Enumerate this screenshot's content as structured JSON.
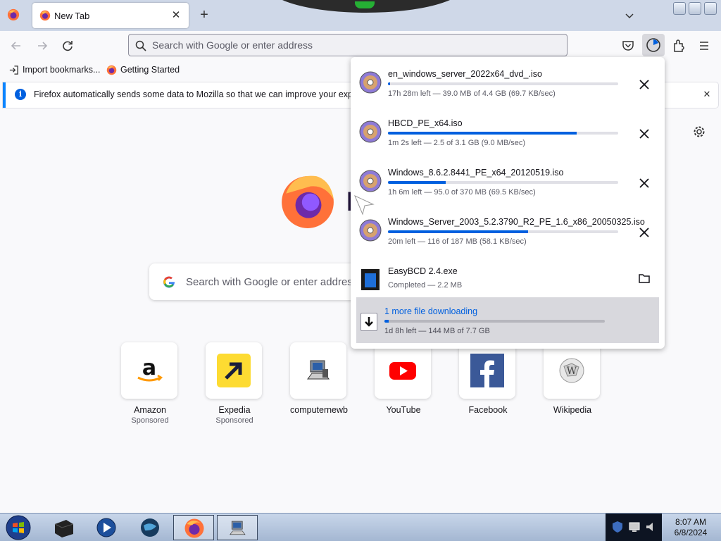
{
  "tabbar": {
    "tab_title": "New Tab",
    "new_tab_glyph": "+",
    "close_glyph": "✕"
  },
  "navbar": {
    "url_placeholder": "Search with Google or enter address"
  },
  "bookmarks": [
    {
      "label": "Import bookmarks...",
      "icon": "import-icon"
    },
    {
      "label": "Getting Started",
      "icon": "firefox-icon"
    }
  ],
  "notice": {
    "text": "Firefox automatically sends some data to Mozilla so that we can improve your experience."
  },
  "newtab": {
    "search_placeholder": "Search with Google or enter address",
    "tiles": [
      {
        "label": "Amazon",
        "sub": "Sponsored",
        "icon": "amazon-icon"
      },
      {
        "label": "Expedia",
        "sub": "Sponsored",
        "icon": "expedia-icon"
      },
      {
        "label": "computernewb",
        "sub": "",
        "icon": "computer-icon"
      },
      {
        "label": "YouTube",
        "sub": "",
        "icon": "youtube-icon"
      },
      {
        "label": "Facebook",
        "sub": "",
        "icon": "facebook-icon"
      },
      {
        "label": "Wikipedia",
        "sub": "",
        "icon": "wikipedia-icon"
      }
    ]
  },
  "downloads": {
    "items": [
      {
        "name": "en_windows_server_2022x64_dvd_.iso",
        "status": "17h 28m left — 39.0 MB of 4.4 GB (69.7 KB/sec)",
        "progress": 0.01,
        "icon": "disc-icon"
      },
      {
        "name": "HBCD_PE_x64.iso",
        "status": "1m 2s left — 2.5 of 3.1 GB (9.0 MB/sec)",
        "progress": 0.82,
        "icon": "disc-icon"
      },
      {
        "name": "Windows_8.6.2.8441_PE_x64_20120519.iso",
        "status": "1h 6m left — 95.0 of 370 MB (69.5 KB/sec)",
        "progress": 0.25,
        "icon": "disc-icon"
      },
      {
        "name": "Windows_Server_2003_5.2.3790_R2_PE_1.6_x86_20050325.iso",
        "status": "20m left — 116 of 187 MB (58.1 KB/sec)",
        "progress": 0.61,
        "icon": "disc-icon"
      },
      {
        "name": "EasyBCD 2.4.exe",
        "status": "Completed — 2.2 MB",
        "progress": 1.0,
        "icon": "exe-icon"
      }
    ],
    "more": {
      "label": "1 more file downloading",
      "status": "1d 8h left — 144 MB of 7.7 GB",
      "progress": 0.02
    }
  },
  "taskbar": {
    "time": "8:07 AM",
    "date": "6/8/2024"
  },
  "colors": {
    "accent": "#0060df",
    "tab_strip": "#cfd8e8",
    "page_bg": "#f9f9fb"
  }
}
